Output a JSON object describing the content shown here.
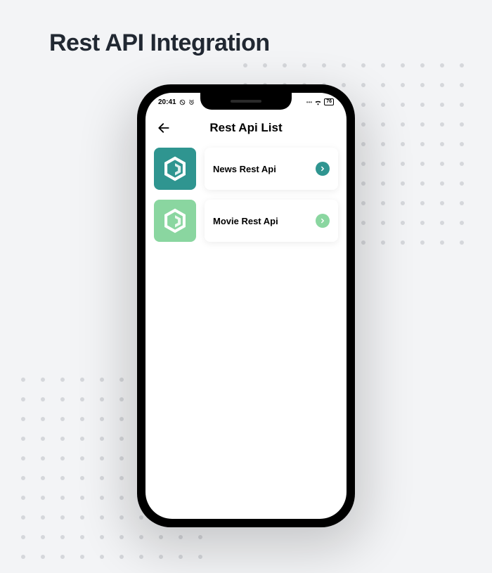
{
  "pageTitle": "Rest API Integration",
  "statusBar": {
    "time": "20:41",
    "battery": "76"
  },
  "header": {
    "title": "Rest Api List"
  },
  "items": [
    {
      "label": "News Rest Api",
      "iconBg": "#2f9590",
      "chevBg": "#2f9590"
    },
    {
      "label": "Movie Rest Api",
      "iconBg": "#8ad6a0",
      "chevBg": "#8ad6a0"
    }
  ]
}
